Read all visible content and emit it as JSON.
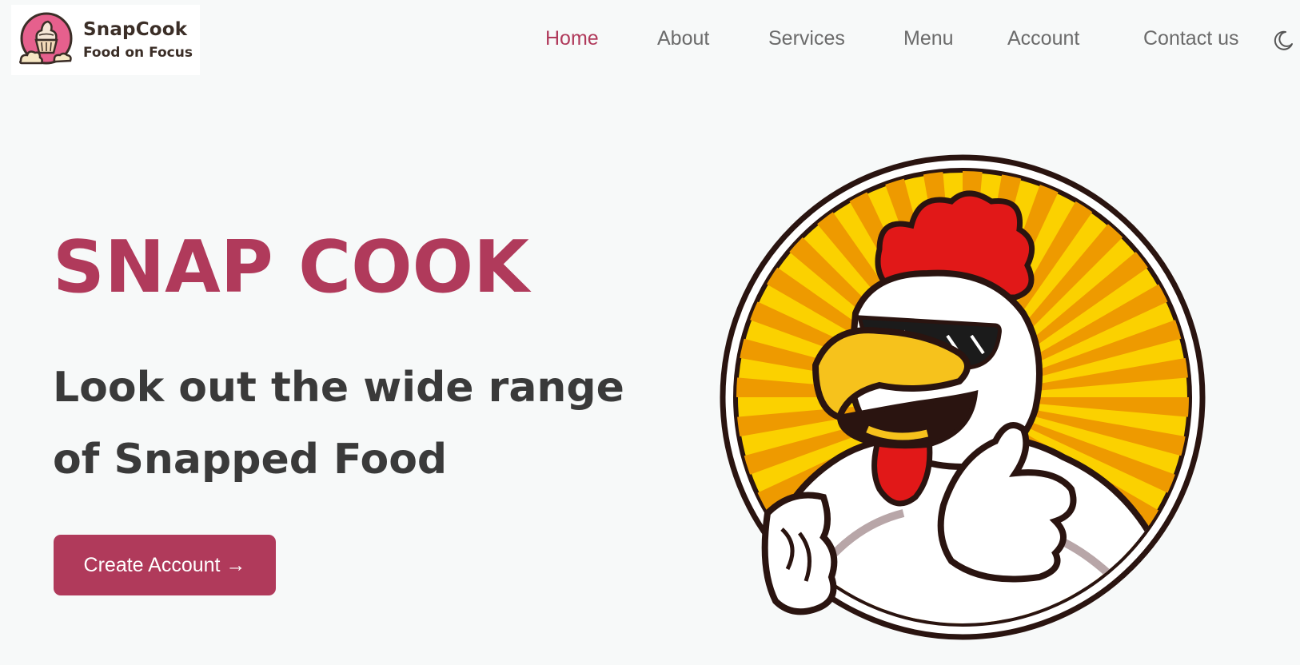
{
  "brand": {
    "name": "SnapCook",
    "tagline": "Food on Focus",
    "accent_color": "#b03a5b",
    "logo_icon": "cupcake-icon"
  },
  "nav": {
    "items": [
      {
        "label": "Home",
        "active": true
      },
      {
        "label": "About",
        "active": false
      },
      {
        "label": "Services",
        "active": false
      },
      {
        "label": "Menu",
        "active": false
      },
      {
        "label": "Account",
        "active": false
      },
      {
        "label": "Contact us",
        "active": false
      }
    ],
    "theme_toggle_icon": "moon-icon"
  },
  "hero": {
    "title": "SNAP COOK",
    "subtitle": "Look out the wide range of Snapped Food",
    "cta_label": "Create Account →",
    "illustration": "rooster-mascot-icon"
  }
}
